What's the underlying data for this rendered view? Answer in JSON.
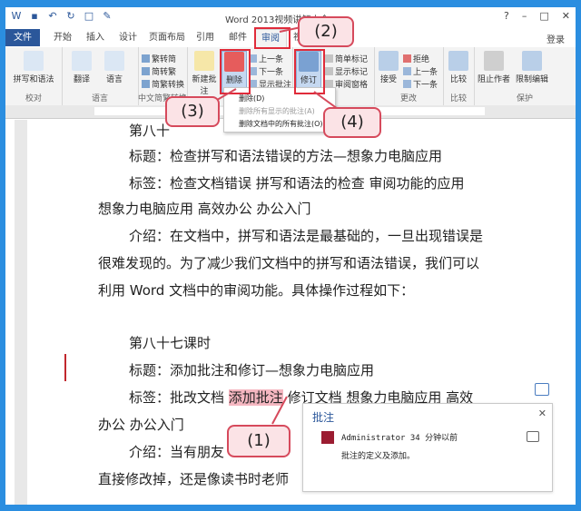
{
  "window": {
    "title": "Word 2013视频讲解大全",
    "login": "登录"
  },
  "tabs": [
    "文件",
    "开始",
    "插入",
    "设计",
    "页面布局",
    "引用",
    "邮件",
    "审阅",
    "视图"
  ],
  "ribbon": {
    "proofing": {
      "spell": "拼写和语法",
      "label": "校对"
    },
    "language": {
      "translate": "翻译",
      "language": "语言",
      "label": "语言"
    },
    "chinese": {
      "s2t": "繁转简",
      "t2s": "简转繁",
      "convert": "简繁转换",
      "label": "中文简繁转换"
    },
    "comments": {
      "new": "新建批注",
      "delete": "删除",
      "prev": "上一条",
      "next": "下一条",
      "show": "显示批注"
    },
    "tracking": {
      "track": "修订",
      "simple": "简单标记",
      "show_markup": "显示标记",
      "pane": "审阅窗格"
    },
    "changes": {
      "accept": "接受",
      "reject": "拒绝",
      "prev": "上一条",
      "next": "下一条",
      "label": "更改"
    },
    "compare": {
      "compare": "比较",
      "label": "比较"
    },
    "protect": {
      "block": "阻止作者",
      "restrict": "限制编辑",
      "label": "保护"
    }
  },
  "dropdown": {
    "items": [
      "删除(D)",
      "删除所有显示的批注(A)",
      "删除文档中的所有批注(O)"
    ]
  },
  "document": {
    "lines": [
      "第八十",
      "标题：检查拼写和语法错误的方法—想象力电脑应用",
      "标签：检查文档错误  拼写和语法的检查  审阅功能的应用",
      "想象力电脑应用  高效办公  办公入门",
      "介绍：在文档中，拼写和语法是最基础的，一旦出现错误是",
      "很难发现的。为了减少我们文档中的拼写和语法错误，我们可以",
      "利用 Word 文档中的审阅功能。具体操作过程如下：",
      "第八十七课时",
      "标题：添加批注和修订—想象力电脑应用",
      "标签：批改文档 ",
      "添加批注",
      " 修订文档  想象力电脑应用  高效",
      "办公  办公入门",
      "介绍：当有朋友",
      "直接修改掉，还是像读书时老师"
    ]
  },
  "comment_pane": {
    "header": "批注",
    "author": "Administrator 34 分钟以前",
    "text": "批注的定义及添加。"
  },
  "callouts": [
    "(1)",
    "(2)",
    "(3)",
    "(4)"
  ],
  "colors": {
    "accent": "#2b579a",
    "highlight": "#f5b7c1",
    "callout_border": "#d64a5c"
  }
}
